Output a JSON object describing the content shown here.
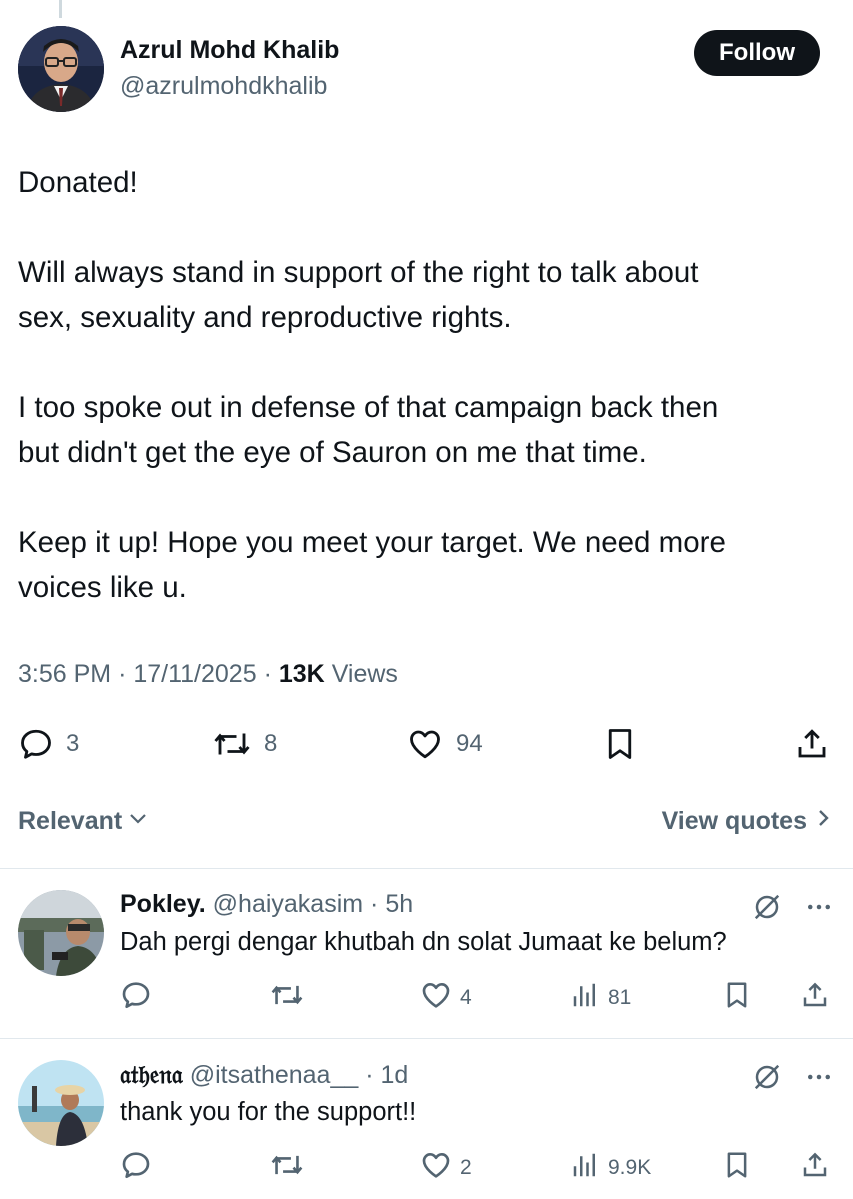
{
  "tweet": {
    "author_name": "Azrul Mohd Khalib",
    "author_handle": "@azrulmohdkhalib",
    "follow_label": "Follow",
    "paragraphs": [
      [
        "Donated!"
      ],
      [
        "Will always stand in support of the right to talk about",
        "sex, sexuality and reproductive rights."
      ],
      [
        "I too spoke out in defense of that campaign back then",
        "but didn't get the eye of Sauron on me that time."
      ],
      [
        "Keep it up! Hope you meet your target. We need more",
        "voices like u."
      ]
    ],
    "time": "3:56 PM",
    "date": "17/11/2025",
    "views_count": "13K",
    "views_label": "Views",
    "replies": "3",
    "reposts": "8",
    "likes": "94",
    "icons": [
      "reply-icon",
      "repost-icon",
      "like-icon",
      "bookmark-icon",
      "share-icon"
    ]
  },
  "sort": {
    "relevant_label": "Relevant",
    "view_quotes_label": "View quotes"
  },
  "replies": [
    {
      "name": "Pokley.",
      "handle": "@haiyakasim",
      "age": "5h",
      "text": "Dah pergi dengar khutbah dn solat Jumaat ke belum?",
      "replies": "",
      "reposts": "",
      "likes": "4",
      "views": "81"
    },
    {
      "name": "𝔞𝔱𝔥𝔢𝔫𝔞",
      "handle": "@itsathenaa__",
      "age": "1d",
      "text": "thank you for the support!!",
      "replies": "",
      "reposts": "",
      "likes": "2",
      "views": "9.9K"
    }
  ],
  "colors": {
    "text": "#0f1419",
    "secondary": "#536471",
    "divider": "#e1e8ed",
    "button_bg": "#0f1419"
  }
}
